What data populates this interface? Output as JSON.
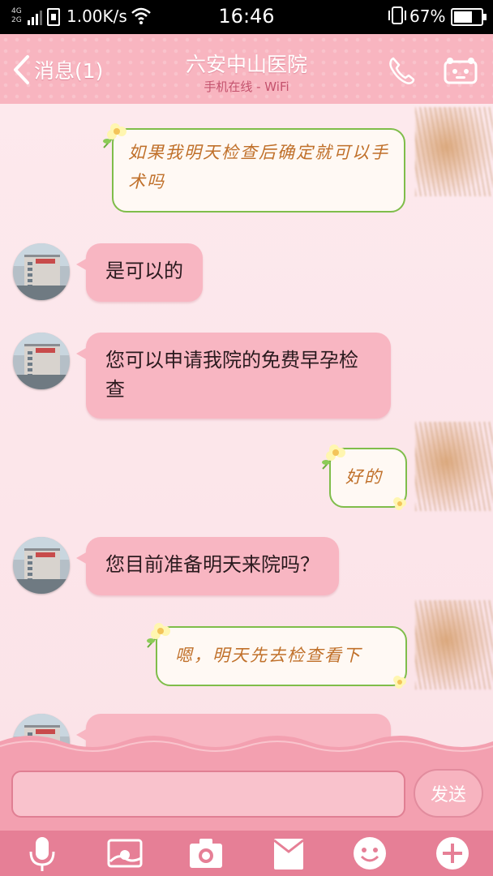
{
  "status_bar": {
    "net_type_top": "4G",
    "net_type_bottom": "2G",
    "net_speed": "1.00K/s",
    "time": "16:46",
    "battery_percent": "67%",
    "battery_level": 0.67
  },
  "header": {
    "back_label": "消息(1)",
    "contact_name": "六安中山医院",
    "subtitle": "手机在线 - WiFi"
  },
  "messages": [
    {
      "from": "me",
      "text": "如果我明天检查后确定就可以手术吗"
    },
    {
      "from": "hospital",
      "text": "是可以的"
    },
    {
      "from": "hospital",
      "text": "您可以申请我院的免费早孕检查"
    },
    {
      "from": "me",
      "text": "好的"
    },
    {
      "from": "hospital",
      "text": "您目前准备明天来院吗？"
    },
    {
      "from": "me",
      "text": "嗯，明天先去检查看下"
    }
  ],
  "input": {
    "value": "",
    "placeholder": "",
    "send_label": "发送"
  },
  "toolbar": {
    "icons": [
      "microphone-icon",
      "image-icon",
      "camera-icon",
      "envelope-icon",
      "emoji-icon",
      "plus-icon"
    ]
  },
  "colors": {
    "header": "#f8b5c0",
    "incoming_bubble": "#f8b6c2",
    "outgoing_border": "#7fbd4a",
    "outgoing_text": "#c0702a",
    "toolbar": "#e67f96"
  }
}
